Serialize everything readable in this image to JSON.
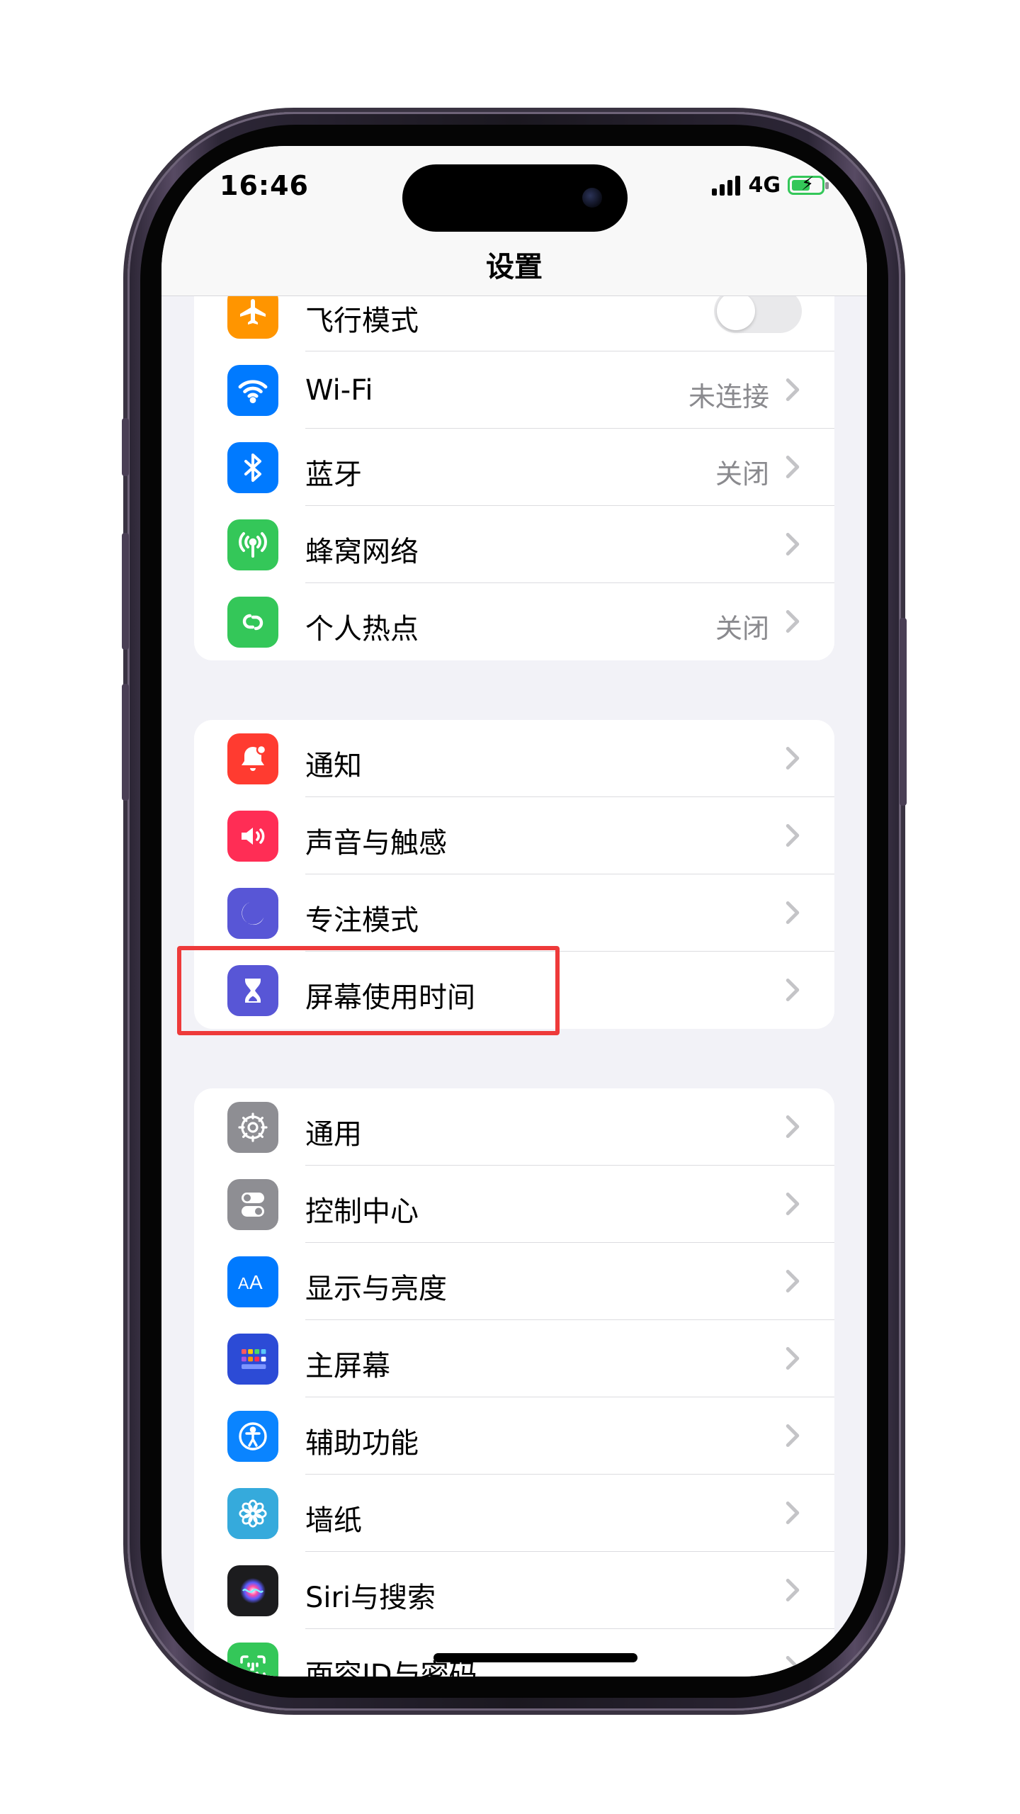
{
  "status_bar": {
    "time": "16:46",
    "network": "4G"
  },
  "nav": {
    "title": "设置"
  },
  "groups": [
    {
      "rows": [
        {
          "label": "飞行模式",
          "control": "toggle",
          "toggle_on": false,
          "icon": "airplane-icon",
          "color": "#ff9500"
        },
        {
          "label": "Wi-Fi",
          "value": "未连接",
          "icon": "wifi-icon",
          "color": "#007aff"
        },
        {
          "label": "蓝牙",
          "value": "关闭",
          "icon": "bluetooth-icon",
          "color": "#007aff"
        },
        {
          "label": "蜂窝网络",
          "value": "",
          "icon": "cellular-icon",
          "color": "#34c759"
        },
        {
          "label": "个人热点",
          "value": "关闭",
          "icon": "hotspot-icon",
          "color": "#34c759"
        }
      ]
    },
    {
      "rows": [
        {
          "label": "通知",
          "icon": "notification-bell-icon",
          "color": "#ff3b30"
        },
        {
          "label": "声音与触感",
          "icon": "speaker-icon",
          "color": "#ff2d55"
        },
        {
          "label": "专注模式",
          "icon": "moon-icon",
          "color": "#5856d6"
        },
        {
          "label": "屏幕使用时间",
          "icon": "hourglass-icon",
          "color": "#5856d6",
          "highlighted": true
        }
      ]
    },
    {
      "rows": [
        {
          "label": "通用",
          "icon": "gear-icon",
          "color": "#8e8e93"
        },
        {
          "label": "控制中心",
          "icon": "toggles-icon",
          "color": "#8e8e93"
        },
        {
          "label": "显示与亮度",
          "icon": "text-size-icon",
          "color": "#007aff"
        },
        {
          "label": "主屏幕",
          "icon": "app-grid-icon",
          "color": "#2c4bd6"
        },
        {
          "label": "辅助功能",
          "icon": "accessibility-icon",
          "color": "#0a84ff"
        },
        {
          "label": "墙纸",
          "icon": "flower-icon",
          "color": "#35aadc"
        },
        {
          "label": "Siri与搜索",
          "icon": "siri-icon",
          "color": "#1c1c1e"
        },
        {
          "label": "面容ID与密码",
          "icon": "face-id-icon",
          "color": "#34c759"
        }
      ]
    }
  ]
}
